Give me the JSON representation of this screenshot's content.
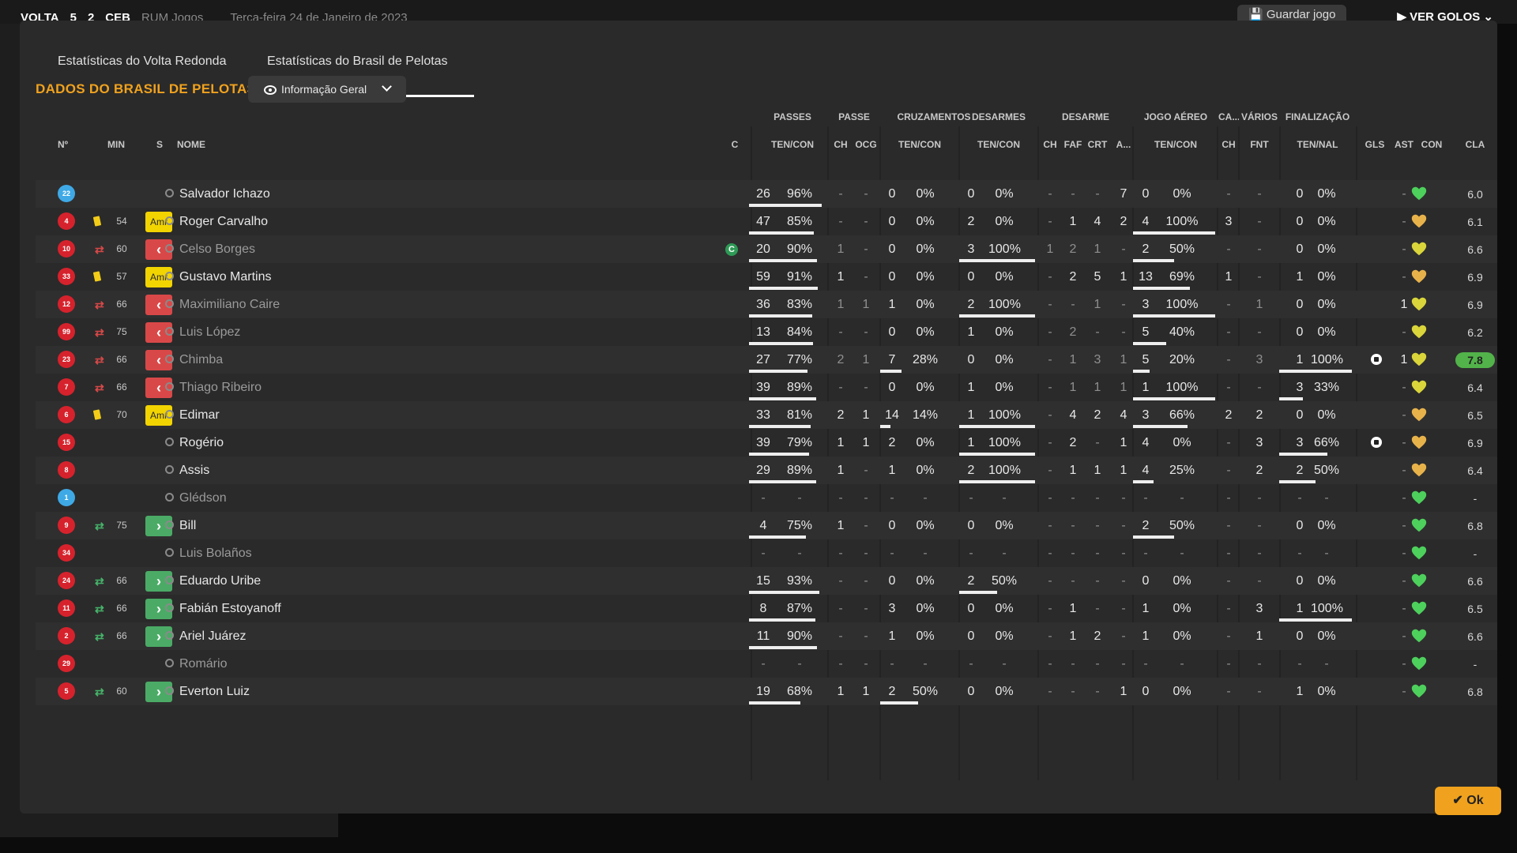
{
  "background": {
    "home": "VOLTA",
    "score_home": "5",
    "score_away": "2",
    "away": "CEB",
    "context": "RUM Jogos",
    "date": "Terça-feira 24 de Janeiro de 2023",
    "save_label": "Guardar jogo",
    "goals_label": "VER GOLOS"
  },
  "tabs": [
    {
      "label": "Estatísticas do Volta Redonda"
    },
    {
      "label": "Estatísticas do Brasil de Pelotas"
    }
  ],
  "section_title": "DADOS DO BRASIL DE PELOTAS",
  "view_dropdown": {
    "label": "Informação Geral"
  },
  "groups": [
    "PASSES",
    "PASSE",
    "CRUZAMENTOS",
    "DESARMES",
    "DESARME",
    "JOGO AÉREO",
    "CA...",
    "VÁRIOS",
    "FINALIZAÇÃO"
  ],
  "columns": [
    "Nº",
    "MIN",
    "S",
    "NOME",
    "C",
    "TEN/CON",
    "CH",
    "OCG",
    "TEN/CON",
    "TEN/CON",
    "CH",
    "FAF",
    "CRT",
    "A...",
    "TEN/CON",
    "CH",
    "FNT",
    "TEN/NAL",
    "GLS",
    "AST",
    "CON",
    "CLA"
  ],
  "players": [
    {
      "num": "22",
      "shirt": "blue",
      "event": "",
      "min": "",
      "status": "",
      "name": "Salvador Ichazo",
      "dim": false,
      "captain": false,
      "pt": "26",
      "pp": "96%",
      "pf": 0.96,
      "pch": "-",
      "ocg": "-",
      "ct": "0",
      "cp": "0%",
      "cf": 0,
      "dt": "0",
      "dp": "0%",
      "df": 0,
      "dch": "-",
      "faf": "-",
      "crt": "-",
      "a": "7",
      "at": "0",
      "ap": "0%",
      "af": 0,
      "cach": "-",
      "fnt": "-",
      "st": "0",
      "sp": "0%",
      "sf": 0,
      "gls": "",
      "ast": "-",
      "rating": "6.0",
      "top": false,
      "heart": "#4dd05c"
    },
    {
      "num": "4",
      "shirt": "red",
      "event": "yellow",
      "min": "54",
      "status": "Amr",
      "name": "Roger Carvalho",
      "dim": false,
      "captain": false,
      "pt": "47",
      "pp": "85%",
      "pf": 0.85,
      "pch": "-",
      "ocg": "-",
      "ct": "0",
      "cp": "0%",
      "cf": 0,
      "dt": "2",
      "dp": "0%",
      "df": 0,
      "dch": "-",
      "faf": "1",
      "crt": "4",
      "a": "2",
      "at": "4",
      "ap": "100%",
      "af": 1,
      "cach": "3",
      "fnt": "-",
      "st": "0",
      "sp": "0%",
      "sf": 0,
      "gls": "",
      "ast": "-",
      "rating": "6.1",
      "top": false,
      "heart": "#e8b24a"
    },
    {
      "num": "10",
      "shirt": "red",
      "event": "out",
      "min": "60",
      "status": "out",
      "name": "Celso Borges",
      "dim": true,
      "captain": true,
      "pt": "20",
      "pp": "90%",
      "pf": 0.9,
      "pch": "1",
      "ocg": "-",
      "ct": "0",
      "cp": "0%",
      "cf": 0,
      "dt": "3",
      "dp": "100%",
      "df": 1,
      "dch": "1",
      "faf": "2",
      "crt": "1",
      "a": "-",
      "at": "2",
      "ap": "50%",
      "af": 0.5,
      "cach": "-",
      "fnt": "-",
      "st": "0",
      "sp": "0%",
      "sf": 0,
      "gls": "",
      "ast": "-",
      "rating": "6.6",
      "top": false,
      "heart": "#d9d53a"
    },
    {
      "num": "33",
      "shirt": "red",
      "event": "yellow",
      "min": "57",
      "status": "Amr",
      "name": "Gustavo Martins",
      "dim": false,
      "captain": false,
      "pt": "59",
      "pp": "91%",
      "pf": 0.91,
      "pch": "1",
      "ocg": "-",
      "ct": "0",
      "cp": "0%",
      "cf": 0,
      "dt": "0",
      "dp": "0%",
      "df": 0,
      "dch": "-",
      "faf": "2",
      "crt": "5",
      "a": "1",
      "at": "13",
      "ap": "69%",
      "af": 0.69,
      "cach": "1",
      "fnt": "-",
      "st": "1",
      "sp": "0%",
      "sf": 0,
      "gls": "",
      "ast": "-",
      "rating": "6.9",
      "top": false,
      "heart": "#e8b24a"
    },
    {
      "num": "12",
      "shirt": "red",
      "event": "out",
      "min": "66",
      "status": "out",
      "name": "Maximiliano Caire",
      "dim": true,
      "captain": false,
      "pt": "36",
      "pp": "83%",
      "pf": 0.83,
      "pch": "1",
      "ocg": "1",
      "ct": "1",
      "cp": "0%",
      "cf": 0,
      "dt": "2",
      "dp": "100%",
      "df": 1,
      "dch": "-",
      "faf": "-",
      "crt": "1",
      "a": "-",
      "at": "3",
      "ap": "100%",
      "af": 1,
      "cach": "-",
      "fnt": "1",
      "st": "0",
      "sp": "0%",
      "sf": 0,
      "gls": "",
      "ast": "1",
      "rating": "6.9",
      "top": false,
      "heart": "#d9d53a"
    },
    {
      "num": "99",
      "shirt": "red",
      "event": "out",
      "min": "75",
      "status": "out",
      "name": "Luis López",
      "dim": true,
      "captain": false,
      "pt": "13",
      "pp": "84%",
      "pf": 0.84,
      "pch": "-",
      "ocg": "-",
      "ct": "0",
      "cp": "0%",
      "cf": 0,
      "dt": "1",
      "dp": "0%",
      "df": 0,
      "dch": "-",
      "faf": "2",
      "crt": "-",
      "a": "-",
      "at": "5",
      "ap": "40%",
      "af": 0.4,
      "cach": "-",
      "fnt": "-",
      "st": "0",
      "sp": "0%",
      "sf": 0,
      "gls": "",
      "ast": "-",
      "rating": "6.2",
      "top": false,
      "heart": "#d9d53a"
    },
    {
      "num": "23",
      "shirt": "red",
      "event": "out",
      "min": "66",
      "status": "out",
      "name": "Chimba",
      "dim": true,
      "captain": false,
      "pt": "27",
      "pp": "77%",
      "pf": 0.77,
      "pch": "2",
      "ocg": "1",
      "ct": "7",
      "cp": "28%",
      "cf": 0.28,
      "dt": "0",
      "dp": "0%",
      "df": 0,
      "dch": "-",
      "faf": "1",
      "crt": "3",
      "a": "1",
      "at": "5",
      "ap": "20%",
      "af": 0.2,
      "cach": "-",
      "fnt": "3",
      "st": "1",
      "sp": "100%",
      "sf": 1,
      "gls": "goal",
      "ast": "1",
      "rating": "7.8",
      "top": true,
      "heart": "#d9d53a"
    },
    {
      "num": "7",
      "shirt": "red",
      "event": "out",
      "min": "66",
      "status": "out",
      "name": "Thiago Ribeiro",
      "dim": true,
      "captain": false,
      "pt": "39",
      "pp": "89%",
      "pf": 0.89,
      "pch": "-",
      "ocg": "-",
      "ct": "0",
      "cp": "0%",
      "cf": 0,
      "dt": "1",
      "dp": "0%",
      "df": 0,
      "dch": "-",
      "faf": "1",
      "crt": "1",
      "a": "1",
      "at": "1",
      "ap": "100%",
      "af": 1,
      "cach": "-",
      "fnt": "-",
      "st": "3",
      "sp": "33%",
      "sf": 0.33,
      "gls": "",
      "ast": "-",
      "rating": "6.4",
      "top": false,
      "heart": "#d9d53a"
    },
    {
      "num": "6",
      "shirt": "red",
      "event": "yellow",
      "min": "70",
      "status": "Amr",
      "name": "Edimar",
      "dim": false,
      "captain": false,
      "pt": "33",
      "pp": "81%",
      "pf": 0.81,
      "pch": "2",
      "ocg": "1",
      "ct": "14",
      "cp": "14%",
      "cf": 0.14,
      "dt": "1",
      "dp": "100%",
      "df": 1,
      "dch": "-",
      "faf": "4",
      "crt": "2",
      "a": "4",
      "at": "3",
      "ap": "66%",
      "af": 0.66,
      "cach": "2",
      "fnt": "2",
      "st": "0",
      "sp": "0%",
      "sf": 0,
      "gls": "",
      "ast": "-",
      "rating": "6.5",
      "top": false,
      "heart": "#e8b24a"
    },
    {
      "num": "15",
      "shirt": "red",
      "event": "",
      "min": "",
      "status": "",
      "name": "Rogério",
      "dim": false,
      "captain": false,
      "pt": "39",
      "pp": "79%",
      "pf": 0.79,
      "pch": "1",
      "ocg": "1",
      "ct": "2",
      "cp": "0%",
      "cf": 0,
      "dt": "1",
      "dp": "100%",
      "df": 1,
      "dch": "-",
      "faf": "2",
      "crt": "-",
      "a": "1",
      "at": "4",
      "ap": "0%",
      "af": 0,
      "cach": "-",
      "fnt": "3",
      "st": "3",
      "sp": "66%",
      "sf": 0.66,
      "gls": "goal",
      "ast": "-",
      "rating": "6.9",
      "top": false,
      "heart": "#e8b24a"
    },
    {
      "num": "8",
      "shirt": "red",
      "event": "",
      "min": "",
      "status": "",
      "name": "Assis",
      "dim": false,
      "captain": false,
      "pt": "29",
      "pp": "89%",
      "pf": 0.89,
      "pch": "1",
      "ocg": "-",
      "ct": "1",
      "cp": "0%",
      "cf": 0,
      "dt": "2",
      "dp": "100%",
      "df": 1,
      "dch": "-",
      "faf": "1",
      "crt": "1",
      "a": "1",
      "at": "4",
      "ap": "25%",
      "af": 0.25,
      "cach": "-",
      "fnt": "2",
      "st": "2",
      "sp": "50%",
      "sf": 0.5,
      "gls": "",
      "ast": "-",
      "rating": "6.4",
      "top": false,
      "heart": "#e8b24a"
    },
    {
      "num": "1",
      "shirt": "blue",
      "event": "",
      "min": "",
      "status": "",
      "name": "Glédson",
      "dim": true,
      "captain": false,
      "pt": "-",
      "pp": "-",
      "pf": 0,
      "pch": "-",
      "ocg": "-",
      "ct": "-",
      "cp": "-",
      "cf": 0,
      "dt": "-",
      "dp": "-",
      "df": 0,
      "dch": "-",
      "faf": "-",
      "crt": "-",
      "a": "-",
      "at": "-",
      "ap": "-",
      "af": 0,
      "cach": "-",
      "fnt": "-",
      "st": "-",
      "sp": "-",
      "sf": 0,
      "gls": "",
      "ast": "-",
      "rating": "-",
      "top": false,
      "heart": "#4dd05c"
    },
    {
      "num": "9",
      "shirt": "red",
      "event": "in",
      "min": "75",
      "status": "in",
      "name": "Bill",
      "dim": false,
      "captain": false,
      "pt": "4",
      "pp": "75%",
      "pf": 0.75,
      "pch": "1",
      "ocg": "-",
      "ct": "0",
      "cp": "0%",
      "cf": 0,
      "dt": "0",
      "dp": "0%",
      "df": 0,
      "dch": "-",
      "faf": "-",
      "crt": "-",
      "a": "-",
      "at": "2",
      "ap": "50%",
      "af": 0.5,
      "cach": "-",
      "fnt": "-",
      "st": "0",
      "sp": "0%",
      "sf": 0,
      "gls": "",
      "ast": "-",
      "rating": "6.8",
      "top": false,
      "heart": "#4dd05c"
    },
    {
      "num": "34",
      "shirt": "red",
      "event": "",
      "min": "",
      "status": "",
      "name": "Luis Bolaños",
      "dim": true,
      "captain": false,
      "pt": "-",
      "pp": "-",
      "pf": 0,
      "pch": "-",
      "ocg": "-",
      "ct": "-",
      "cp": "-",
      "cf": 0,
      "dt": "-",
      "dp": "-",
      "df": 0,
      "dch": "-",
      "faf": "-",
      "crt": "-",
      "a": "-",
      "at": "-",
      "ap": "-",
      "af": 0,
      "cach": "-",
      "fnt": "-",
      "st": "-",
      "sp": "-",
      "sf": 0,
      "gls": "",
      "ast": "-",
      "rating": "-",
      "top": false,
      "heart": "#4dd05c"
    },
    {
      "num": "24",
      "shirt": "red",
      "event": "in",
      "min": "66",
      "status": "in",
      "name": "Eduardo Uribe",
      "dim": false,
      "captain": false,
      "pt": "15",
      "pp": "93%",
      "pf": 0.93,
      "pch": "-",
      "ocg": "-",
      "ct": "0",
      "cp": "0%",
      "cf": 0,
      "dt": "2",
      "dp": "50%",
      "df": 0.5,
      "dch": "-",
      "faf": "-",
      "crt": "-",
      "a": "-",
      "at": "0",
      "ap": "0%",
      "af": 0,
      "cach": "-",
      "fnt": "-",
      "st": "0",
      "sp": "0%",
      "sf": 0,
      "gls": "",
      "ast": "-",
      "rating": "6.6",
      "top": false,
      "heart": "#4dd05c"
    },
    {
      "num": "11",
      "shirt": "red",
      "event": "in",
      "min": "66",
      "status": "in",
      "name": "Fabián Estoyanoff",
      "dim": false,
      "captain": false,
      "pt": "8",
      "pp": "87%",
      "pf": 0.87,
      "pch": "-",
      "ocg": "-",
      "ct": "3",
      "cp": "0%",
      "cf": 0,
      "dt": "0",
      "dp": "0%",
      "df": 0,
      "dch": "-",
      "faf": "1",
      "crt": "-",
      "a": "-",
      "at": "1",
      "ap": "0%",
      "af": 0,
      "cach": "-",
      "fnt": "3",
      "st": "1",
      "sp": "100%",
      "sf": 1,
      "gls": "",
      "ast": "-",
      "rating": "6.5",
      "top": false,
      "heart": "#4dd05c"
    },
    {
      "num": "2",
      "shirt": "red",
      "event": "in",
      "min": "66",
      "status": "in",
      "name": "Ariel Juárez",
      "dim": false,
      "captain": false,
      "pt": "11",
      "pp": "90%",
      "pf": 0.9,
      "pch": "-",
      "ocg": "-",
      "ct": "1",
      "cp": "0%",
      "cf": 0,
      "dt": "0",
      "dp": "0%",
      "df": 0,
      "dch": "-",
      "faf": "1",
      "crt": "2",
      "a": "-",
      "at": "1",
      "ap": "0%",
      "af": 0,
      "cach": "-",
      "fnt": "1",
      "st": "0",
      "sp": "0%",
      "sf": 0,
      "gls": "",
      "ast": "-",
      "rating": "6.6",
      "top": false,
      "heart": "#4dd05c"
    },
    {
      "num": "29",
      "shirt": "red",
      "event": "",
      "min": "",
      "status": "",
      "name": "Romário",
      "dim": true,
      "captain": false,
      "pt": "-",
      "pp": "-",
      "pf": 0,
      "pch": "-",
      "ocg": "-",
      "ct": "-",
      "cp": "-",
      "cf": 0,
      "dt": "-",
      "dp": "-",
      "df": 0,
      "dch": "-",
      "faf": "-",
      "crt": "-",
      "a": "-",
      "at": "-",
      "ap": "-",
      "af": 0,
      "cach": "-",
      "fnt": "-",
      "st": "-",
      "sp": "-",
      "sf": 0,
      "gls": "",
      "ast": "-",
      "rating": "-",
      "top": false,
      "heart": "#4dd05c"
    },
    {
      "num": "5",
      "shirt": "red",
      "event": "in",
      "min": "60",
      "status": "in",
      "name": "Everton Luiz",
      "dim": false,
      "captain": false,
      "pt": "19",
      "pp": "68%",
      "pf": 0.68,
      "pch": "1",
      "ocg": "1",
      "ct": "2",
      "cp": "50%",
      "cf": 0.5,
      "dt": "0",
      "dp": "0%",
      "df": 0,
      "dch": "-",
      "faf": "-",
      "crt": "-",
      "a": "1",
      "at": "0",
      "ap": "0%",
      "af": 0,
      "cach": "-",
      "fnt": "-",
      "st": "1",
      "sp": "0%",
      "sf": 0,
      "gls": "",
      "ast": "-",
      "rating": "6.8",
      "top": false,
      "heart": "#4dd05c"
    }
  ],
  "ok_label": "Ok",
  "colors": {
    "accent": "#f0a21e",
    "yellow_card": "#f2d400",
    "sub_out": "#d94848",
    "sub_in": "#4bab66",
    "top_rating": "#52b34a"
  }
}
